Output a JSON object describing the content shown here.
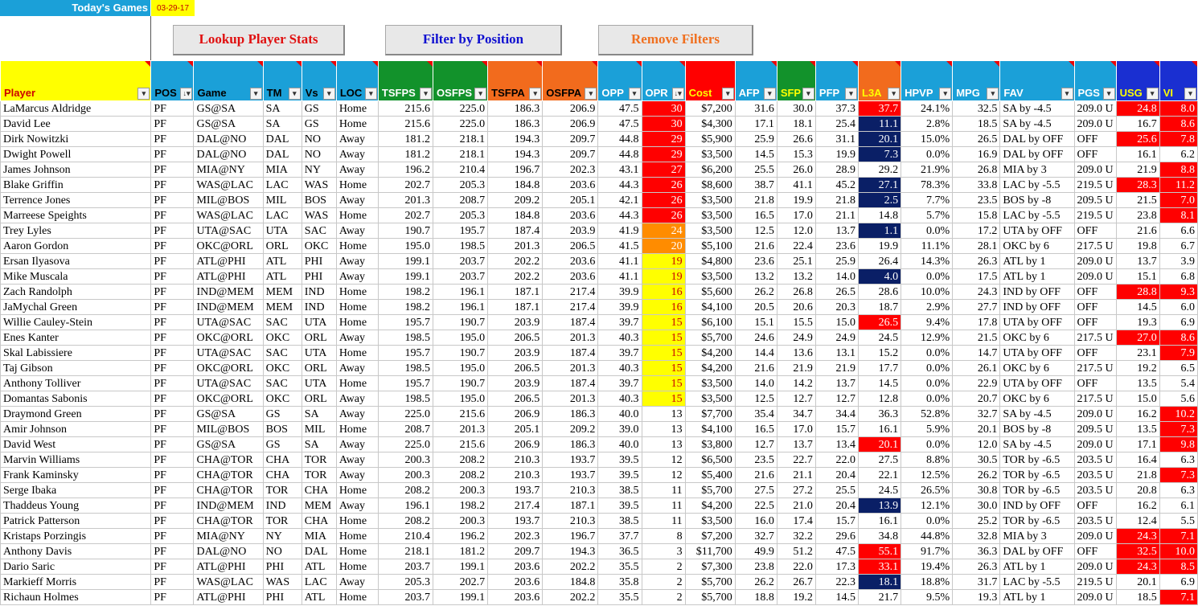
{
  "header": {
    "title": "Today's Games",
    "date": "03-29-17"
  },
  "buttons": {
    "lookup": "Lookup Player Stats",
    "filter": "Filter by Position",
    "remove": "Remove Filters"
  },
  "columns": [
    {
      "key": "player",
      "label": "Player",
      "bg": "#ffff00",
      "fg": "#cc0000",
      "sort": false
    },
    {
      "key": "pos",
      "label": "POS",
      "bg": "#1ba0d8",
      "fg": "#000",
      "sort": true
    },
    {
      "key": "game",
      "label": "Game",
      "bg": "#1ba0d8",
      "fg": "#000",
      "sort": false
    },
    {
      "key": "tm",
      "label": "TM",
      "bg": "#1ba0d8",
      "fg": "#000",
      "sort": false
    },
    {
      "key": "vs",
      "label": "Vs",
      "bg": "#1ba0d8",
      "fg": "#000",
      "sort": false
    },
    {
      "key": "loc",
      "label": "LOC",
      "bg": "#1ba0d8",
      "fg": "#000",
      "sort": false
    },
    {
      "key": "tsfps",
      "label": "TSFPS",
      "bg": "#12922b",
      "fg": "#fff",
      "sort": false
    },
    {
      "key": "osfps",
      "label": "OSFPS",
      "bg": "#12922b",
      "fg": "#fff",
      "sort": false
    },
    {
      "key": "tsfpa",
      "label": "TSFPA",
      "bg": "#f26b1d",
      "fg": "#000",
      "sort": false
    },
    {
      "key": "osfpa",
      "label": "OSFPA",
      "bg": "#f26b1d",
      "fg": "#000",
      "sort": false
    },
    {
      "key": "opp",
      "label": "OPP",
      "bg": "#1ba0d8",
      "fg": "#fff",
      "sort": false
    },
    {
      "key": "opr",
      "label": "OPR",
      "bg": "#1ba0d8",
      "fg": "#fff",
      "sort": true
    },
    {
      "key": "cost",
      "label": "Cost",
      "bg": "#ff0000",
      "fg": "#ffff00",
      "sort": false
    },
    {
      "key": "afp",
      "label": "AFP",
      "bg": "#1ba0d8",
      "fg": "#fff",
      "sort": false
    },
    {
      "key": "sfp",
      "label": "SFP",
      "bg": "#12922b",
      "fg": "#ffff00",
      "sort": false
    },
    {
      "key": "pfp",
      "label": "PFP",
      "bg": "#1ba0d8",
      "fg": "#fff",
      "sort": false
    },
    {
      "key": "l3a",
      "label": "L3A",
      "bg": "#f26b1d",
      "fg": "#ffff00",
      "sort": false
    },
    {
      "key": "hpvp",
      "label": "HPVP",
      "bg": "#1ba0d8",
      "fg": "#fff",
      "sort": false
    },
    {
      "key": "mpg",
      "label": "MPG",
      "bg": "#1ba0d8",
      "fg": "#fff",
      "sort": false
    },
    {
      "key": "fav",
      "label": "FAV",
      "bg": "#1ba0d8",
      "fg": "#fff",
      "sort": false
    },
    {
      "key": "pgs",
      "label": "PGS",
      "bg": "#1ba0d8",
      "fg": "#fff",
      "sort": false
    },
    {
      "key": "usg",
      "label": "USG",
      "bg": "#1a2fd1",
      "fg": "#ffff00",
      "sort": false
    },
    {
      "key": "vi",
      "label": "VI",
      "bg": "#1a2fd1",
      "fg": "#ffff00",
      "sort": false
    }
  ],
  "highlight_colors": {
    "red": "#ff0000",
    "navy": "#0a1f66",
    "orange": "#ff8c00",
    "yellow": "#ffff00"
  },
  "rows": [
    [
      "LaMarcus Aldridge",
      "PF",
      "GS@SA",
      "SA",
      "GS",
      "Home",
      "215.6",
      "225.0",
      "186.3",
      "206.9",
      "47.5",
      "30",
      "$7,200",
      "31.6",
      "30.0",
      "37.3",
      "37.7",
      "24.1%",
      "32.5",
      "SA by -4.5",
      "209.0 U",
      "24.8",
      "8.0"
    ],
    [
      "David Lee",
      "PF",
      "GS@SA",
      "SA",
      "GS",
      "Home",
      "215.6",
      "225.0",
      "186.3",
      "206.9",
      "47.5",
      "30",
      "$4,300",
      "17.1",
      "18.1",
      "25.4",
      "11.1",
      "2.8%",
      "18.5",
      "SA by -4.5",
      "209.0 U",
      "16.7",
      "8.6"
    ],
    [
      "Dirk Nowitzki",
      "PF",
      "DAL@NO",
      "DAL",
      "NO",
      "Away",
      "181.2",
      "218.1",
      "194.3",
      "209.7",
      "44.8",
      "29",
      "$5,900",
      "25.9",
      "26.6",
      "31.1",
      "20.1",
      "15.0%",
      "26.5",
      "DAL by OFF",
      "OFF",
      "25.6",
      "7.8"
    ],
    [
      "Dwight Powell",
      "PF",
      "DAL@NO",
      "DAL",
      "NO",
      "Away",
      "181.2",
      "218.1",
      "194.3",
      "209.7",
      "44.8",
      "29",
      "$3,500",
      "14.5",
      "15.3",
      "19.9",
      "7.3",
      "0.0%",
      "16.9",
      "DAL by OFF",
      "OFF",
      "16.1",
      "6.2"
    ],
    [
      "James Johnson",
      "PF",
      "MIA@NY",
      "MIA",
      "NY",
      "Away",
      "196.2",
      "210.4",
      "196.7",
      "202.3",
      "43.1",
      "27",
      "$6,200",
      "25.5",
      "26.0",
      "28.9",
      "29.2",
      "21.9%",
      "26.8",
      "MIA by 3",
      "209.0 U",
      "21.9",
      "8.8"
    ],
    [
      "Blake Griffin",
      "PF",
      "WAS@LAC",
      "LAC",
      "WAS",
      "Home",
      "202.7",
      "205.3",
      "184.8",
      "203.6",
      "44.3",
      "26",
      "$8,600",
      "38.7",
      "41.1",
      "45.2",
      "27.1",
      "78.3%",
      "33.8",
      "LAC by -5.5",
      "219.5 U",
      "28.3",
      "11.2"
    ],
    [
      "Terrence Jones",
      "PF",
      "MIL@BOS",
      "MIL",
      "BOS",
      "Away",
      "201.3",
      "208.7",
      "209.2",
      "205.1",
      "42.1",
      "26",
      "$3,500",
      "21.8",
      "19.9",
      "21.8",
      "2.5",
      "7.7%",
      "23.5",
      "BOS by -8",
      "209.5 U",
      "21.5",
      "7.0"
    ],
    [
      "Marreese Speights",
      "PF",
      "WAS@LAC",
      "LAC",
      "WAS",
      "Home",
      "202.7",
      "205.3",
      "184.8",
      "203.6",
      "44.3",
      "26",
      "$3,500",
      "16.5",
      "17.0",
      "21.1",
      "14.8",
      "5.7%",
      "15.8",
      "LAC by -5.5",
      "219.5 U",
      "23.8",
      "8.1"
    ],
    [
      "Trey Lyles",
      "PF",
      "UTA@SAC",
      "UTA",
      "SAC",
      "Away",
      "190.7",
      "195.7",
      "187.4",
      "203.9",
      "41.9",
      "24",
      "$3,500",
      "12.5",
      "12.0",
      "13.7",
      "1.1",
      "0.0%",
      "17.2",
      "UTA by OFF",
      "OFF",
      "21.6",
      "6.6"
    ],
    [
      "Aaron Gordon",
      "PF",
      "OKC@ORL",
      "ORL",
      "OKC",
      "Home",
      "195.0",
      "198.5",
      "201.3",
      "206.5",
      "41.5",
      "20",
      "$5,100",
      "21.6",
      "22.4",
      "23.6",
      "19.9",
      "11.1%",
      "28.1",
      "OKC by 6",
      "217.5 U",
      "19.8",
      "6.7"
    ],
    [
      "Ersan Ilyasova",
      "PF",
      "ATL@PHI",
      "ATL",
      "PHI",
      "Away",
      "199.1",
      "203.7",
      "202.2",
      "203.6",
      "41.1",
      "19",
      "$4,800",
      "23.6",
      "25.1",
      "25.9",
      "26.4",
      "14.3%",
      "26.3",
      "ATL by 1",
      "209.0 U",
      "13.7",
      "3.9"
    ],
    [
      "Mike Muscala",
      "PF",
      "ATL@PHI",
      "ATL",
      "PHI",
      "Away",
      "199.1",
      "203.7",
      "202.2",
      "203.6",
      "41.1",
      "19",
      "$3,500",
      "13.2",
      "13.2",
      "14.0",
      "4.0",
      "0.0%",
      "17.5",
      "ATL by 1",
      "209.0 U",
      "15.1",
      "6.8"
    ],
    [
      "Zach Randolph",
      "PF",
      "IND@MEM",
      "MEM",
      "IND",
      "Home",
      "198.2",
      "196.1",
      "187.1",
      "217.4",
      "39.9",
      "16",
      "$5,600",
      "26.2",
      "26.8",
      "26.5",
      "28.6",
      "10.0%",
      "24.3",
      "IND by OFF",
      "OFF",
      "28.8",
      "9.3"
    ],
    [
      "JaMychal Green",
      "PF",
      "IND@MEM",
      "MEM",
      "IND",
      "Home",
      "198.2",
      "196.1",
      "187.1",
      "217.4",
      "39.9",
      "16",
      "$4,100",
      "20.5",
      "20.6",
      "20.3",
      "18.7",
      "2.9%",
      "27.7",
      "IND by OFF",
      "OFF",
      "14.5",
      "6.0"
    ],
    [
      "Willie Cauley-Stein",
      "PF",
      "UTA@SAC",
      "SAC",
      "UTA",
      "Home",
      "195.7",
      "190.7",
      "203.9",
      "187.4",
      "39.7",
      "15",
      "$6,100",
      "15.1",
      "15.5",
      "15.0",
      "26.5",
      "9.4%",
      "17.8",
      "UTA by OFF",
      "OFF",
      "19.3",
      "6.9"
    ],
    [
      "Enes Kanter",
      "PF",
      "OKC@ORL",
      "OKC",
      "ORL",
      "Away",
      "198.5",
      "195.0",
      "206.5",
      "201.3",
      "40.3",
      "15",
      "$5,700",
      "24.6",
      "24.9",
      "24.9",
      "24.5",
      "12.9%",
      "21.5",
      "OKC by 6",
      "217.5 U",
      "27.0",
      "8.6"
    ],
    [
      "Skal Labissiere",
      "PF",
      "UTA@SAC",
      "SAC",
      "UTA",
      "Home",
      "195.7",
      "190.7",
      "203.9",
      "187.4",
      "39.7",
      "15",
      "$4,200",
      "14.4",
      "13.6",
      "13.1",
      "15.2",
      "0.0%",
      "14.7",
      "UTA by OFF",
      "OFF",
      "23.1",
      "7.9"
    ],
    [
      "Taj Gibson",
      "PF",
      "OKC@ORL",
      "OKC",
      "ORL",
      "Away",
      "198.5",
      "195.0",
      "206.5",
      "201.3",
      "40.3",
      "15",
      "$4,200",
      "21.6",
      "21.9",
      "21.9",
      "17.7",
      "0.0%",
      "26.1",
      "OKC by 6",
      "217.5 U",
      "19.2",
      "6.5"
    ],
    [
      "Anthony Tolliver",
      "PF",
      "UTA@SAC",
      "SAC",
      "UTA",
      "Home",
      "195.7",
      "190.7",
      "203.9",
      "187.4",
      "39.7",
      "15",
      "$3,500",
      "14.0",
      "14.2",
      "13.7",
      "14.5",
      "0.0%",
      "22.9",
      "UTA by OFF",
      "OFF",
      "13.5",
      "5.4"
    ],
    [
      "Domantas Sabonis",
      "PF",
      "OKC@ORL",
      "OKC",
      "ORL",
      "Away",
      "198.5",
      "195.0",
      "206.5",
      "201.3",
      "40.3",
      "15",
      "$3,500",
      "12.5",
      "12.7",
      "12.7",
      "12.8",
      "0.0%",
      "20.7",
      "OKC by 6",
      "217.5 U",
      "15.0",
      "5.6"
    ],
    [
      "Draymond Green",
      "PF",
      "GS@SA",
      "GS",
      "SA",
      "Away",
      "225.0",
      "215.6",
      "206.9",
      "186.3",
      "40.0",
      "13",
      "$7,700",
      "35.4",
      "34.7",
      "34.4",
      "36.3",
      "52.8%",
      "32.7",
      "SA by -4.5",
      "209.0 U",
      "16.2",
      "10.2"
    ],
    [
      "Amir Johnson",
      "PF",
      "MIL@BOS",
      "BOS",
      "MIL",
      "Home",
      "208.7",
      "201.3",
      "205.1",
      "209.2",
      "39.0",
      "13",
      "$4,100",
      "16.5",
      "17.0",
      "15.7",
      "16.1",
      "5.9%",
      "20.1",
      "BOS by -8",
      "209.5 U",
      "13.5",
      "7.3"
    ],
    [
      "David West",
      "PF",
      "GS@SA",
      "GS",
      "SA",
      "Away",
      "225.0",
      "215.6",
      "206.9",
      "186.3",
      "40.0",
      "13",
      "$3,800",
      "12.7",
      "13.7",
      "13.4",
      "20.1",
      "0.0%",
      "12.0",
      "SA by -4.5",
      "209.0 U",
      "17.1",
      "9.8"
    ],
    [
      "Marvin Williams",
      "PF",
      "CHA@TOR",
      "CHA",
      "TOR",
      "Away",
      "200.3",
      "208.2",
      "210.3",
      "193.7",
      "39.5",
      "12",
      "$6,500",
      "23.5",
      "22.7",
      "22.0",
      "27.5",
      "8.8%",
      "30.5",
      "TOR by -6.5",
      "203.5 U",
      "16.4",
      "6.3"
    ],
    [
      "Frank Kaminsky",
      "PF",
      "CHA@TOR",
      "CHA",
      "TOR",
      "Away",
      "200.3",
      "208.2",
      "210.3",
      "193.7",
      "39.5",
      "12",
      "$5,400",
      "21.6",
      "21.1",
      "20.4",
      "22.1",
      "12.5%",
      "26.2",
      "TOR by -6.5",
      "203.5 U",
      "21.8",
      "7.3"
    ],
    [
      "Serge Ibaka",
      "PF",
      "CHA@TOR",
      "TOR",
      "CHA",
      "Home",
      "208.2",
      "200.3",
      "193.7",
      "210.3",
      "38.5",
      "11",
      "$5,700",
      "27.5",
      "27.2",
      "25.5",
      "24.5",
      "26.5%",
      "30.8",
      "TOR by -6.5",
      "203.5 U",
      "20.8",
      "6.3"
    ],
    [
      "Thaddeus Young",
      "PF",
      "IND@MEM",
      "IND",
      "MEM",
      "Away",
      "196.1",
      "198.2",
      "217.4",
      "187.1",
      "39.5",
      "11",
      "$4,200",
      "22.5",
      "21.0",
      "20.4",
      "13.9",
      "12.1%",
      "30.0",
      "IND by OFF",
      "OFF",
      "16.2",
      "6.1"
    ],
    [
      "Patrick Patterson",
      "PF",
      "CHA@TOR",
      "TOR",
      "CHA",
      "Home",
      "208.2",
      "200.3",
      "193.7",
      "210.3",
      "38.5",
      "11",
      "$3,500",
      "16.0",
      "17.4",
      "15.7",
      "16.1",
      "0.0%",
      "25.2",
      "TOR by -6.5",
      "203.5 U",
      "12.4",
      "5.5"
    ],
    [
      "Kristaps Porzingis",
      "PF",
      "MIA@NY",
      "NY",
      "MIA",
      "Home",
      "210.4",
      "196.2",
      "202.3",
      "196.7",
      "37.7",
      "8",
      "$7,200",
      "32.7",
      "32.2",
      "29.6",
      "34.8",
      "44.8%",
      "32.8",
      "MIA by 3",
      "209.0 U",
      "24.3",
      "7.1"
    ],
    [
      "Anthony Davis",
      "PF",
      "DAL@NO",
      "NO",
      "DAL",
      "Home",
      "218.1",
      "181.2",
      "209.7",
      "194.3",
      "36.5",
      "3",
      "$11,700",
      "49.9",
      "51.2",
      "47.5",
      "55.1",
      "91.7%",
      "36.3",
      "DAL by OFF",
      "OFF",
      "32.5",
      "10.0"
    ],
    [
      "Dario Saric",
      "PF",
      "ATL@PHI",
      "PHI",
      "ATL",
      "Home",
      "203.7",
      "199.1",
      "203.6",
      "202.2",
      "35.5",
      "2",
      "$7,300",
      "23.8",
      "22.0",
      "17.3",
      "33.1",
      "19.4%",
      "26.3",
      "ATL by 1",
      "209.0 U",
      "24.3",
      "8.5"
    ],
    [
      "Markieff Morris",
      "PF",
      "WAS@LAC",
      "WAS",
      "LAC",
      "Away",
      "205.3",
      "202.7",
      "203.6",
      "184.8",
      "35.8",
      "2",
      "$5,700",
      "26.2",
      "26.7",
      "22.3",
      "18.1",
      "18.8%",
      "31.7",
      "LAC by -5.5",
      "219.5 U",
      "20.1",
      "6.9"
    ],
    [
      "Richaun Holmes",
      "PF",
      "ATL@PHI",
      "PHI",
      "ATL",
      "Home",
      "203.7",
      "199.1",
      "203.6",
      "202.2",
      "35.5",
      "2",
      "$5,700",
      "18.8",
      "19.2",
      "14.5",
      "21.7",
      "9.5%",
      "19.3",
      "ATL by 1",
      "209.0 U",
      "18.5",
      "7.1"
    ]
  ]
}
